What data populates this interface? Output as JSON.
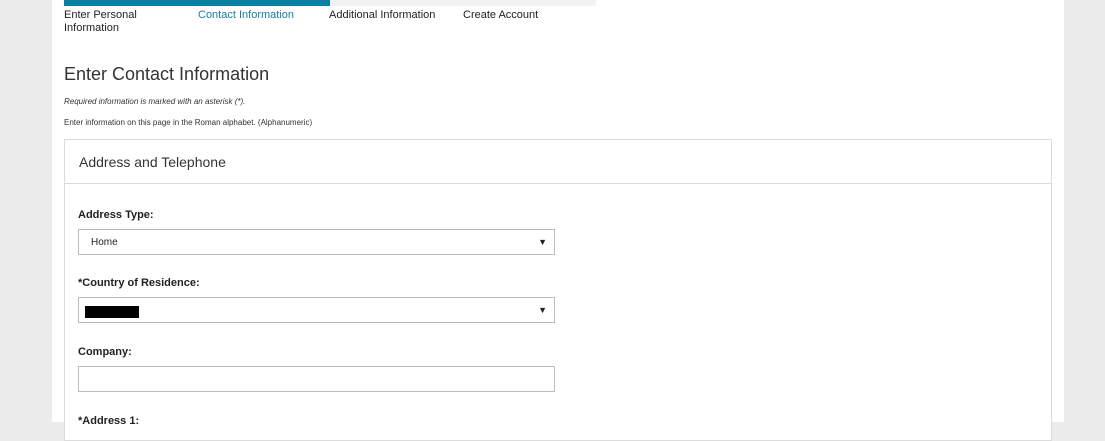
{
  "progress": {
    "fraction": 0.5,
    "steps": [
      {
        "label": "Enter Personal Information"
      },
      {
        "label": "Contact Information"
      },
      {
        "label": "Additional Information"
      },
      {
        "label": "Create Account"
      }
    ],
    "active_color": "#0e7fa3"
  },
  "page": {
    "title": "Enter Contact Information",
    "required_note": "Required information is marked with an asterisk (*).",
    "alphabet_note": "Enter information on this page in the Roman alphabet. (Alphanumeric)"
  },
  "panel": {
    "title": "Address and Telephone",
    "address_type": {
      "label": "Address Type:",
      "value": "Home"
    },
    "country": {
      "label": "*Country of Residence:",
      "value": ""
    },
    "company": {
      "label": "Company:",
      "value": ""
    },
    "address1": {
      "label": "*Address 1:"
    }
  }
}
